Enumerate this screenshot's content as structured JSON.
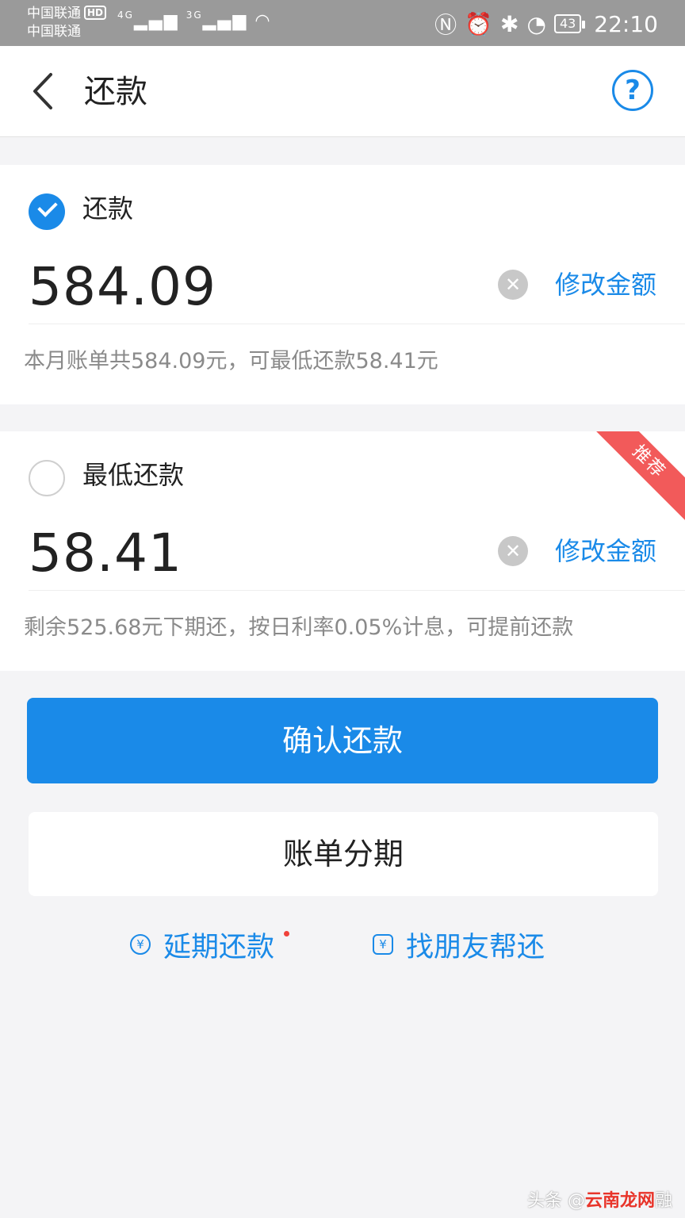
{
  "status_bar": {
    "carrier_1": "中国联通",
    "hd_badge": "HD",
    "carrier_2": "中国联通",
    "signal_1": "4G",
    "signal_2": "3G",
    "battery": "43",
    "time": "22:10"
  },
  "header": {
    "title": "还款"
  },
  "options": [
    {
      "label": "还款",
      "checked": true,
      "amount": "584.09",
      "edit_label": "修改金额",
      "note": "本月账单共584.09元，可最低还款58.41元"
    },
    {
      "label": "最低还款",
      "checked": false,
      "amount": "58.41",
      "edit_label": "修改金额",
      "note": "剩余525.68元下期还，按日利率0.05%计息，可提前还款",
      "badge": "推荐"
    }
  ],
  "buttons": {
    "confirm": "确认还款",
    "installment": "账单分期"
  },
  "links": {
    "defer": "延期还款",
    "friend": "找朋友帮还"
  },
  "watermark": {
    "prefix": "头条 @",
    "brand": "云南龙网",
    "suffix": "融"
  },
  "colors": {
    "accent": "#1a8ae8",
    "badge": "#f25a5a",
    "status_bar": "#9a9a9a"
  }
}
